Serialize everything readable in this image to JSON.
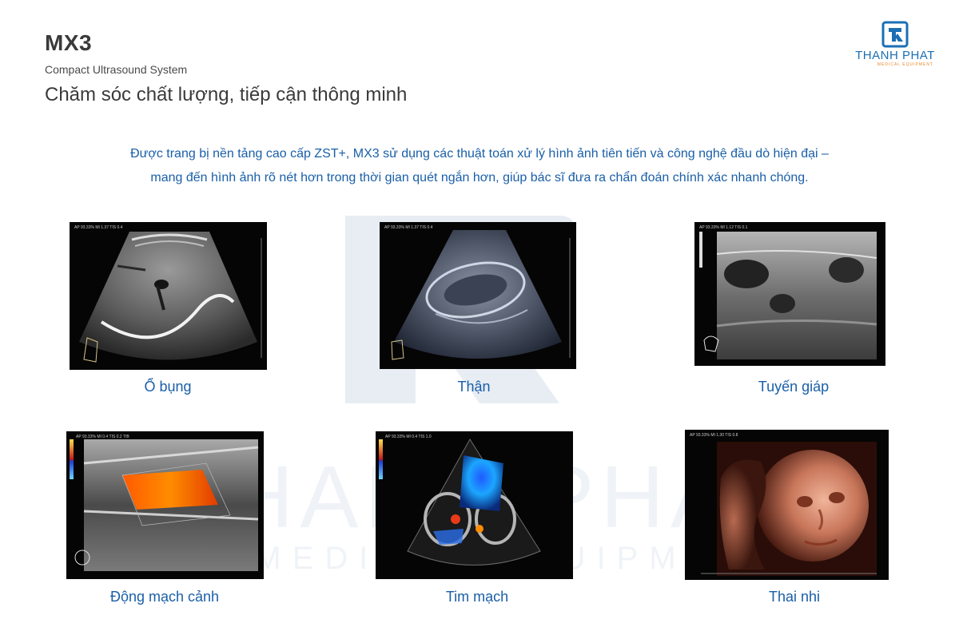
{
  "header": {
    "product_name": "MX3",
    "product_subtitle": "Compact Ultrasound System",
    "slogan": "Chăm sóc chất lượng, tiếp cận thông minh"
  },
  "logo": {
    "name": "THANH PHAT",
    "tagline": "MEDICAL EQUIPMENT",
    "icon": "tp-logo-icon",
    "color": "#1a6fb5",
    "accent": "#e9882a"
  },
  "intro": {
    "line1": "Được trang bị nền tảng cao cấp ZST+, MX3 sử dụng các thuật toán xử lý hình ảnh tiên tiến và công nghệ đầu dò hiện đại –",
    "line2": "mang đến hình ảnh rõ nét hơn trong thời gian quét ngắn hơn, giúp bác sĩ đưa ra chẩn đoán chính xác nhanh chóng."
  },
  "watermark": {
    "text_top": "THANH PHAT",
    "text_bottom": "MEDICAL EQUIPMENT"
  },
  "images": [
    {
      "caption": "Ổ bụng",
      "overlay": "AP 93.33%  MI 1.37  TIS 0.4"
    },
    {
      "caption": "Thận",
      "overlay": "AP 93.33%  MI 1.37  TIS 0.4"
    },
    {
      "caption": "Tuyến giáp",
      "overlay": "AP 93.33%  MI 1.12  TIS 0.1"
    },
    {
      "caption": "Động mạch cảnh",
      "overlay": "AP 93.33%  MI 0.4  TIS 0.2  TIB"
    },
    {
      "caption": "Tim mạch",
      "overlay": "AP 93.33%  MI 0.4  TIS 1.0"
    },
    {
      "caption": "Thai nhi",
      "overlay": "AP 93.33%  MI 1.30  TIS 0.8"
    }
  ],
  "colors": {
    "heading": "#3a3a3a",
    "blue_text": "#1a5fa8",
    "watermark": "#cfd9e6"
  }
}
